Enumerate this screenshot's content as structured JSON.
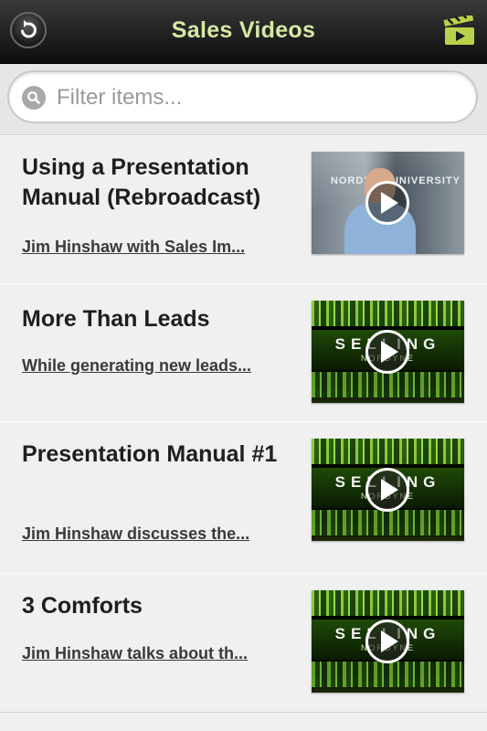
{
  "header": {
    "title": "Sales Videos",
    "back_icon": "back-arrow-icon",
    "right_icon": "clapperboard-icon",
    "title_color": "#d6e9a4"
  },
  "search": {
    "placeholder": "Filter items...",
    "value": ""
  },
  "videos": [
    {
      "title": "Using a Presentation Manual (Rebroadcast)",
      "description": "Jim Hinshaw with Sales Im...",
      "thumbnail": "office",
      "thumb_sign": "NORDYNE UNIVERSITY"
    },
    {
      "title": "More Than Leads",
      "description": "While generating new leads...",
      "thumbnail": "green",
      "thumb_word": "SELLING",
      "thumb_sub": "NORDYNE"
    },
    {
      "title": "Presentation Manual #1",
      "description": "Jim Hinshaw discusses the...",
      "thumbnail": "green",
      "thumb_word": "SELLING",
      "thumb_sub": "NORDYNE"
    },
    {
      "title": "3 Comforts",
      "description": "Jim Hinshaw talks about th...",
      "thumbnail": "green",
      "thumb_word": "SELLING",
      "thumb_sub": "NORDYNE"
    }
  ]
}
